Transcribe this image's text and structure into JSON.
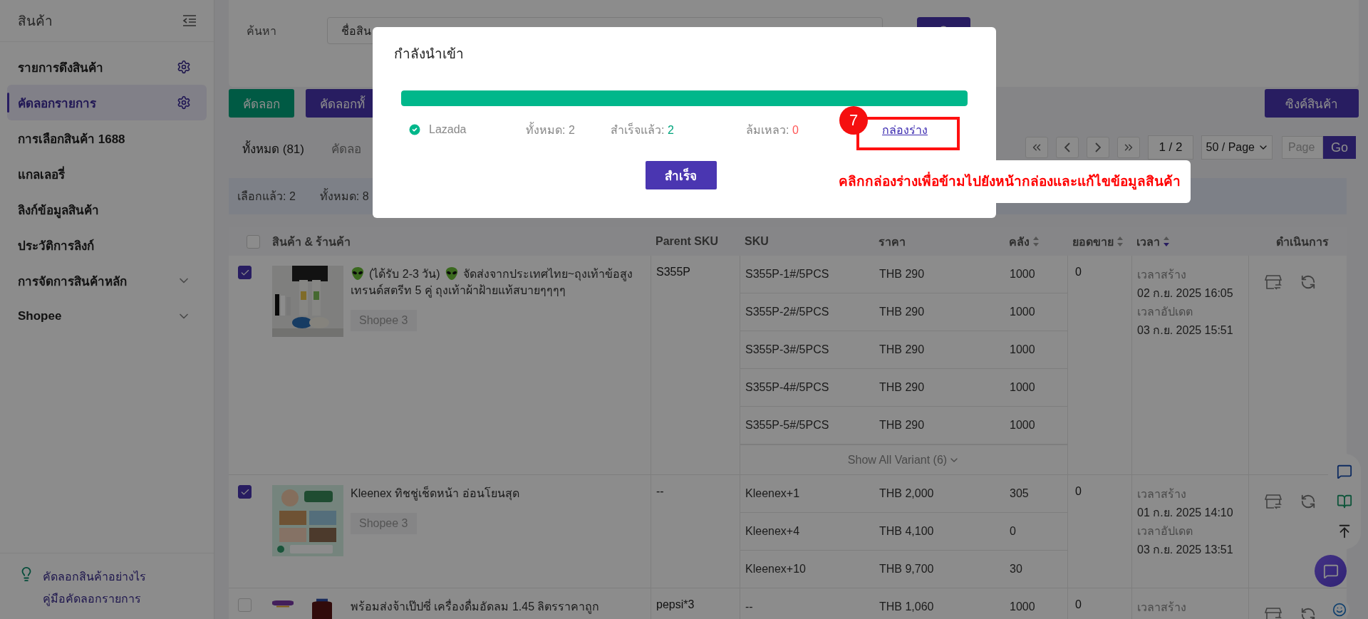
{
  "sidebar": {
    "title": "สินค้า",
    "items": [
      {
        "label": "รายการดึงสินค้า",
        "kind": "settings",
        "selected": false
      },
      {
        "label": "คัดลอกรายการ",
        "kind": "settings",
        "selected": true
      },
      {
        "label": "การเลือกสินค้า 1688",
        "kind": "plain",
        "selected": false
      },
      {
        "label": "แกลเลอรี่",
        "kind": "plain",
        "selected": false
      },
      {
        "label": "ลิงก์ข้อมูลสินค้า",
        "kind": "plain",
        "selected": false
      },
      {
        "label": "ประวัติการลิงก์",
        "kind": "plain",
        "selected": false
      },
      {
        "label": "การจัดการสินค้าหลัก",
        "kind": "group",
        "selected": false
      },
      {
        "label": "Shopee",
        "kind": "group",
        "selected": false
      }
    ],
    "help_links": [
      "คัดลอกสินค้าอย่างไร",
      "คู่มือคัดลอกรายการ"
    ]
  },
  "search": {
    "label": "ค้นหา",
    "field_value": "ชื่อสิน"
  },
  "toolbar": {
    "buttons": [
      {
        "label": "คัดลอก",
        "kind": "green"
      },
      {
        "label": "คัดลอกทั้",
        "kind": "purple"
      }
    ],
    "sync_button": "ซิงค์สินค้า"
  },
  "filter_tabs": [
    {
      "label": "ทั้งหมด (81)",
      "selected": true
    },
    {
      "label": "คัดลอ",
      "selected": false
    }
  ],
  "pagination": {
    "page": "1 / 2",
    "page_size": "50 / Page",
    "page_placeholder": "Page",
    "go_button": "Go"
  },
  "selection_bar": {
    "selected": "เลือกแล้ว: 2",
    "total": "ทั้งหมด: 8"
  },
  "table": {
    "header_checked": false,
    "columns": [
      {
        "label": "สินค้า & ร้านค้า"
      },
      {
        "label": "Parent SKU"
      },
      {
        "label": "SKU"
      },
      {
        "label": "ราคา"
      },
      {
        "label": "คลัง",
        "sorted": false
      },
      {
        "label": "ยอดขาย",
        "sorted": false
      },
      {
        "label": "เวลา",
        "sorted": true
      },
      {
        "label": "ดำเนินการ"
      }
    ],
    "rows": [
      {
        "checked": true,
        "title": [
          {
            "kind": "icon"
          },
          {
            "kind": "text",
            "text": "(ได้รับ 2-3 วัน)"
          },
          {
            "kind": "icon"
          },
          {
            "kind": "text",
            "text": "จัดส่งจากประเทศไทย~ถุงเท้าข้อสูงเทรนด์สตรีท 5 คู่ ถุงเท้าผ้าฝ้ายแท้สบายๆๆๆๆ"
          }
        ],
        "shop": "Shopee 3",
        "parent_sku": "S355P",
        "variants": [
          {
            "sku": "S355P-1#/5PCS",
            "price": "THB 290",
            "stock": "1000"
          },
          {
            "sku": "S355P-2#/5PCS",
            "price": "THB 290",
            "stock": "1000"
          },
          {
            "sku": "S355P-3#/5PCS",
            "price": "THB 290",
            "stock": "1000"
          },
          {
            "sku": "S355P-4#/5PCS",
            "price": "THB 290",
            "stock": "1000"
          },
          {
            "sku": "S355P-5#/5PCS",
            "price": "THB 290",
            "stock": "1000"
          }
        ],
        "show_all": "Show All Variant (6)",
        "sales": "0",
        "created_label": "เวลาสร้าง",
        "created": "02 ก.ย. 2025 16:05",
        "updated_label": "เวลาอัปเดต",
        "updated": "03 ก.ย. 2025 15:51"
      },
      {
        "checked": true,
        "title": [
          {
            "kind": "text",
            "text": "Kleenex ทิชชู่เช็ดหน้า อ่อนโยนสุด"
          }
        ],
        "shop": "Shopee 3",
        "parent_sku": "--",
        "variants": [
          {
            "sku": "Kleenex+1",
            "price": "THB 2,000",
            "stock": "305"
          },
          {
            "sku": "Kleenex+4",
            "price": "THB 4,100",
            "stock": "0"
          },
          {
            "sku": "Kleenex+10",
            "price": "THB 9,700",
            "stock": "30"
          }
        ],
        "sales": "0",
        "created_label": "เวลาสร้าง",
        "created": "01 ก.ย. 2025 14:10",
        "updated_label": "เวลาอัปเดต",
        "updated": "03 ก.ย. 2025 13:51"
      },
      {
        "checked": false,
        "title": [
          {
            "kind": "text",
            "text": "พร้อมส่งจ้าเป๊ปซี่ เครื่องดื่มอัดลม 1.45 ลิตรราคาถูก"
          }
        ],
        "parent_sku": "pepsi*3",
        "variants": [
          {
            "sku": "--",
            "price": "THB 1,060",
            "stock": "1000"
          }
        ],
        "sales": "0",
        "created_label": "เวลาสร้าง"
      }
    ]
  },
  "modal": {
    "title": "กำลังนำเข้า",
    "progress": {
      "level": 1
    },
    "platform": "Lazada",
    "total": "ทั้งหมด: 2",
    "success_label": "สำเร็จแล้ว:",
    "success_count": "2",
    "failed_label": "ล้มเหลว:",
    "failed_count": "0",
    "draft_link": "กล่องร่าง",
    "done_button": "สำเร็จ"
  },
  "annotation": {
    "badge": "7",
    "note": "คลิกกล่องร่างเพื่อข้ามไปยังหน้ากล่องและแก้ไขข้อมูลสินค้า"
  }
}
